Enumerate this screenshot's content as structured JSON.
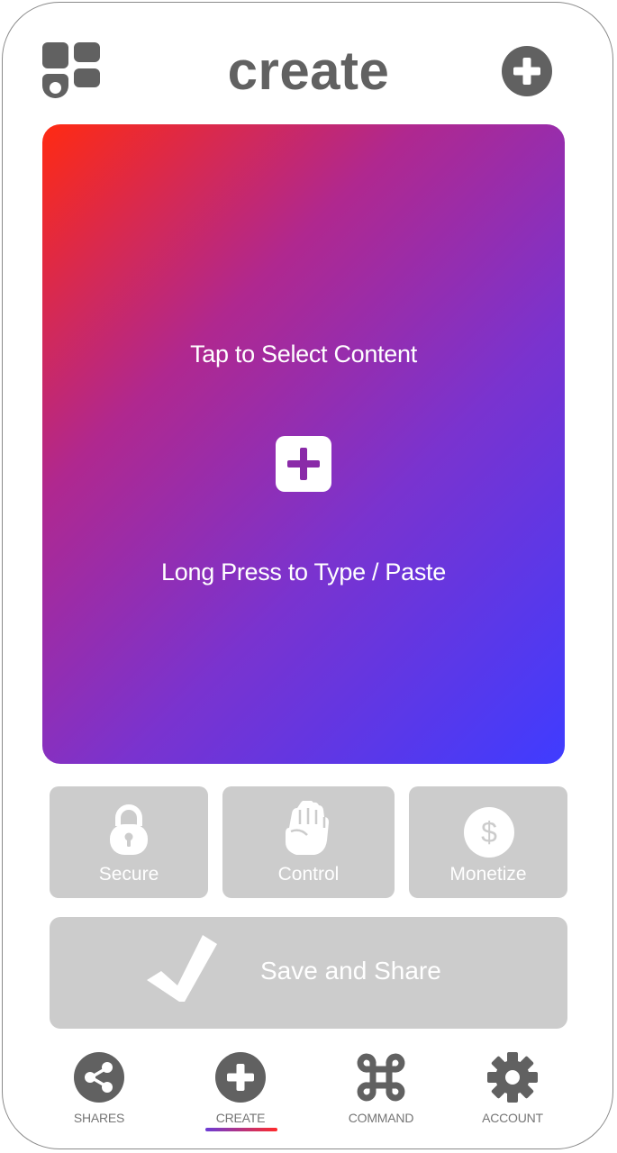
{
  "header": {
    "title": "create",
    "menu_icon": "grid-icon",
    "add_icon": "plus-circle-icon",
    "icon_color": "#616161"
  },
  "content_card": {
    "tap_text": "Tap to Select Content",
    "long_press_text": "Long Press to Type / Paste",
    "add_icon": "plus-square-icon",
    "gradient": [
      "#ff2a12",
      "#b0288f",
      "#7a33cf",
      "#3f3cff"
    ]
  },
  "features": [
    {
      "label": "Secure",
      "icon": "lock-icon"
    },
    {
      "label": "Control",
      "icon": "fist-icon"
    },
    {
      "label": "Monetize",
      "icon": "dollar-circle-icon"
    }
  ],
  "save": {
    "label": "Save and Share",
    "icon": "checkmark-icon"
  },
  "nav": {
    "items": [
      {
        "label": "SHARES",
        "icon": "share-icon"
      },
      {
        "label": "CREATE",
        "icon": "plus-circle-icon",
        "active": true
      },
      {
        "label": "COMMAND",
        "icon": "command-key-icon"
      },
      {
        "label": "ACCOUNT",
        "icon": "gear-icon"
      }
    ]
  },
  "colors": {
    "tile_bg": "#cccccc",
    "nav_text": "#757575",
    "active_underline": [
      "#6b3cd6",
      "#ff2a2a"
    ]
  }
}
